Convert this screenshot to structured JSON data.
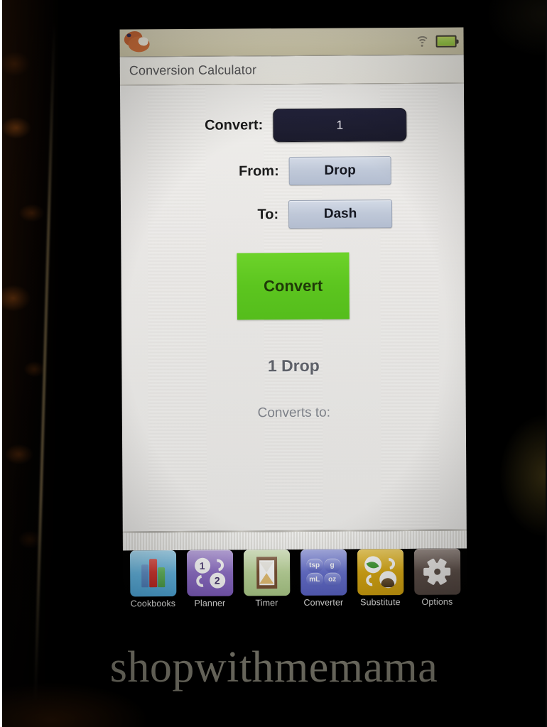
{
  "statusbar": {
    "logo_name": "cooking-app-logo",
    "wifi_icon": "wifi-icon",
    "battery_icon": "battery-icon"
  },
  "titlebar": {
    "title": "Conversion Calculator"
  },
  "form": {
    "convert_label": "Convert:",
    "convert_value": "1",
    "from_label": "From:",
    "from_value": "Drop",
    "to_label": "To:",
    "to_value": "Dash",
    "convert_button": "Convert"
  },
  "result": {
    "primary": "1 Drop",
    "secondary": "Converts to:"
  },
  "toolbar": {
    "items": [
      {
        "label": "Cookbooks",
        "icon": "cookbooks-icon",
        "color": "#63b7e4"
      },
      {
        "label": "Planner",
        "icon": "planner-icon",
        "color": "#8f6fc9"
      },
      {
        "label": "Timer",
        "icon": "timer-icon",
        "color": "#bcd79a"
      },
      {
        "label": "Converter",
        "icon": "converter-icon",
        "color": "#6670cf"
      },
      {
        "label": "Substitute",
        "icon": "substitute-icon",
        "color": "#dcab14"
      },
      {
        "label": "Options",
        "icon": "options-icon",
        "color": "#5e504a"
      }
    ],
    "converter_units": [
      "tsp",
      "g",
      "mL",
      "oz"
    ],
    "planner_numbers": [
      "1",
      "2"
    ]
  },
  "watermark": {
    "text": "shopwithmemama"
  },
  "colors": {
    "accent_green": "#5cc51f",
    "input_dark": "#1b1b2c",
    "picker_blue": "#bfc8d8",
    "statusbar_tan": "#d8d2b4"
  }
}
